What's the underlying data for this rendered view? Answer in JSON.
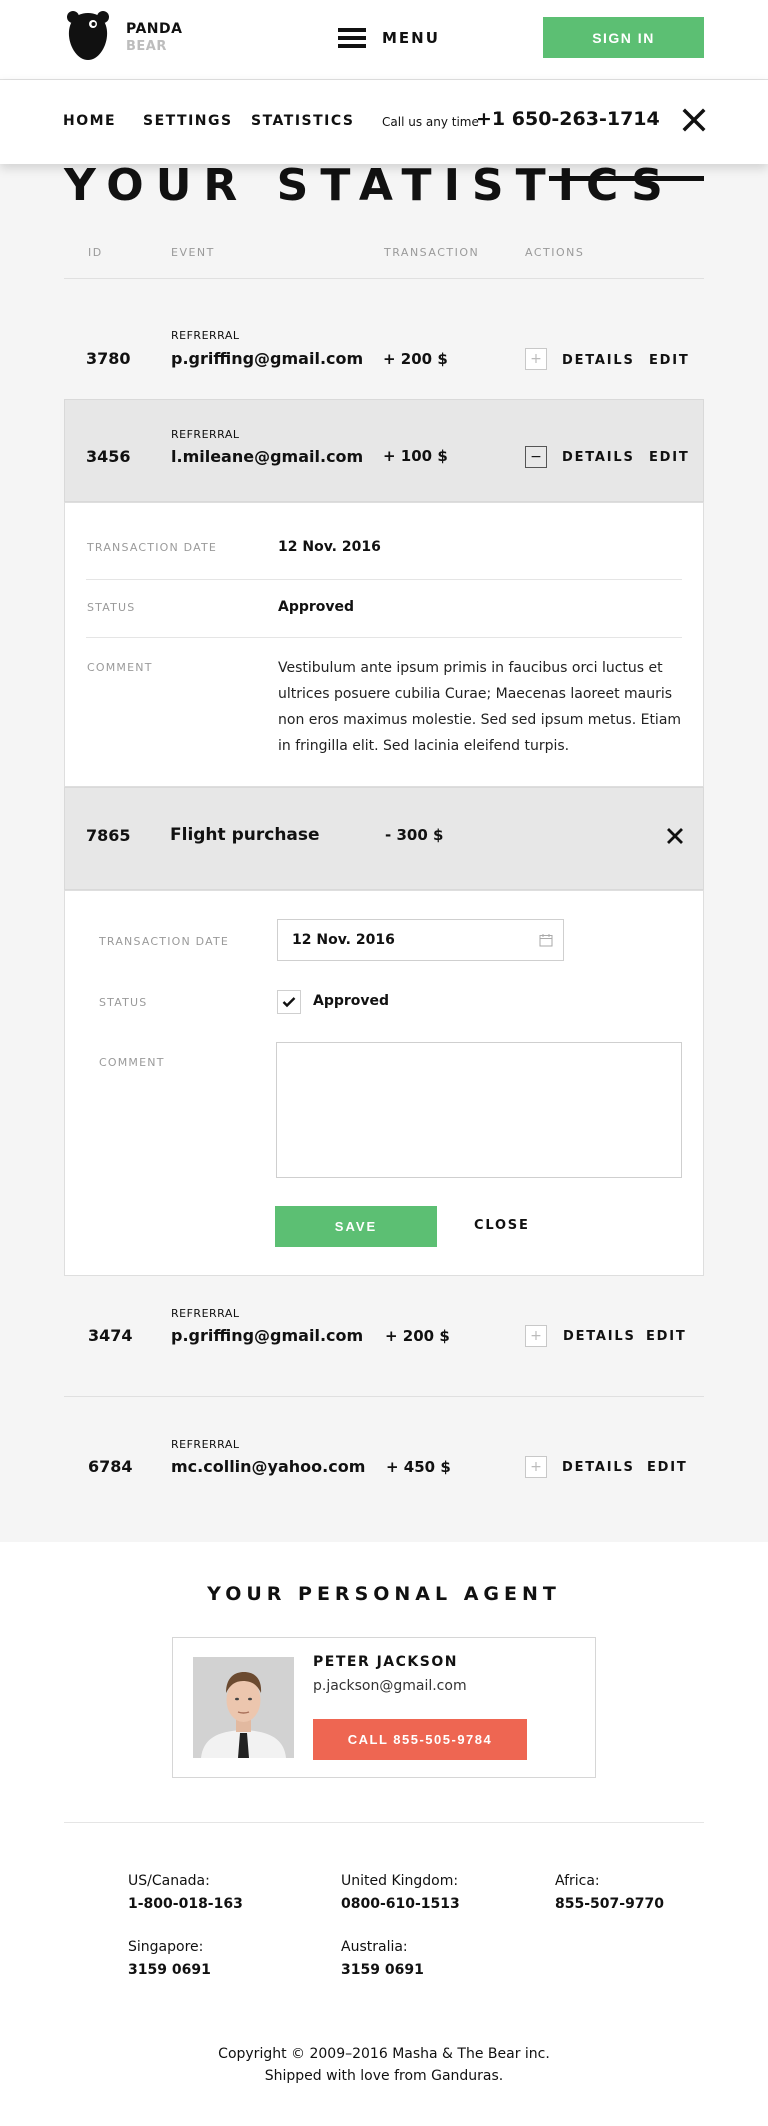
{
  "header": {
    "brand_line1": "PANDA",
    "brand_line2": "BEAR",
    "menu_label": "MENU",
    "signin_label": "SIGN IN"
  },
  "nav": {
    "items": [
      "HOME",
      "SETTINGS",
      "STATISTICS"
    ],
    "call_text": "Call us any time",
    "phone": "+1 650-263-1714"
  },
  "stats": {
    "title": "YOUR STATISTICS",
    "columns": [
      "ID",
      "EVENT",
      "TRANSACTION",
      "ACTIONS"
    ],
    "details_label": "DETAILS",
    "edit_label": "EDIT",
    "rows": [
      {
        "id": "3780",
        "type": "REFRERRAL",
        "email": "p.griffing@gmail.com",
        "amount": "+ 200 $",
        "toggle": "+"
      },
      {
        "id": "3456",
        "type": "REFRERRAL",
        "email": "l.mileane@gmail.com",
        "amount": "+ 100 $",
        "toggle": "−"
      },
      {
        "id": "7865",
        "event": "Flight purchase",
        "amount": "- 300 $"
      },
      {
        "id": "3474",
        "type": "REFRERRAL",
        "email": "p.griffing@gmail.com",
        "amount": "+ 200 $",
        "toggle": "+"
      },
      {
        "id": "6784",
        "type": "REFRERRAL",
        "email": "mc.collin@yahoo.com",
        "amount": "+ 450 $",
        "toggle": "+"
      }
    ],
    "detail": {
      "date_label": "TRANSACTION DATE",
      "date_value": "12 Nov. 2016",
      "status_label": "STATUS",
      "status_value": "Approved",
      "comment_label": "COMMENT",
      "comment_value": "Vestibulum ante ipsum primis in faucibus orci luctus et ultrices posuere cubilia Curae; Maecenas laoreet mauris non eros maximus molestie. Sed sed ipsum metus. Etiam in fringilla elit. Sed lacinia eleifend turpis."
    },
    "edit_form": {
      "date_label": "TRANSACTION DATE",
      "date_value": "12 Nov. 2016",
      "status_label": "STATUS",
      "status_value": "Approved",
      "comment_label": "COMMENT",
      "comment_value": "",
      "save_label": "SAVE",
      "close_label": "CLOSE"
    }
  },
  "agent": {
    "title": "YOUR PERSONAL AGENT",
    "name": "PETER JACKSON",
    "email": "p.jackson@gmail.com",
    "call_label": "CALL 855-505-9784"
  },
  "footer": {
    "locations": [
      {
        "name": "US/Canada:",
        "phone": "1-800-018-163"
      },
      {
        "name": "United Kingdom:",
        "phone": "0800-610-1513"
      },
      {
        "name": "Africa:",
        "phone": "855-507-9770"
      },
      {
        "name": "Singapore:",
        "phone": "3159 0691"
      },
      {
        "name": "Australia:",
        "phone": "3159 0691"
      }
    ],
    "copyright_line1": "Copyright © 2009–2016 Masha & The Bear inc.",
    "copyright_line2": "Shipped with love from Ganduras."
  },
  "colors": {
    "accent_green": "#5cbf73",
    "accent_red": "#ee6652",
    "section_bg": "#f5f5f5"
  }
}
